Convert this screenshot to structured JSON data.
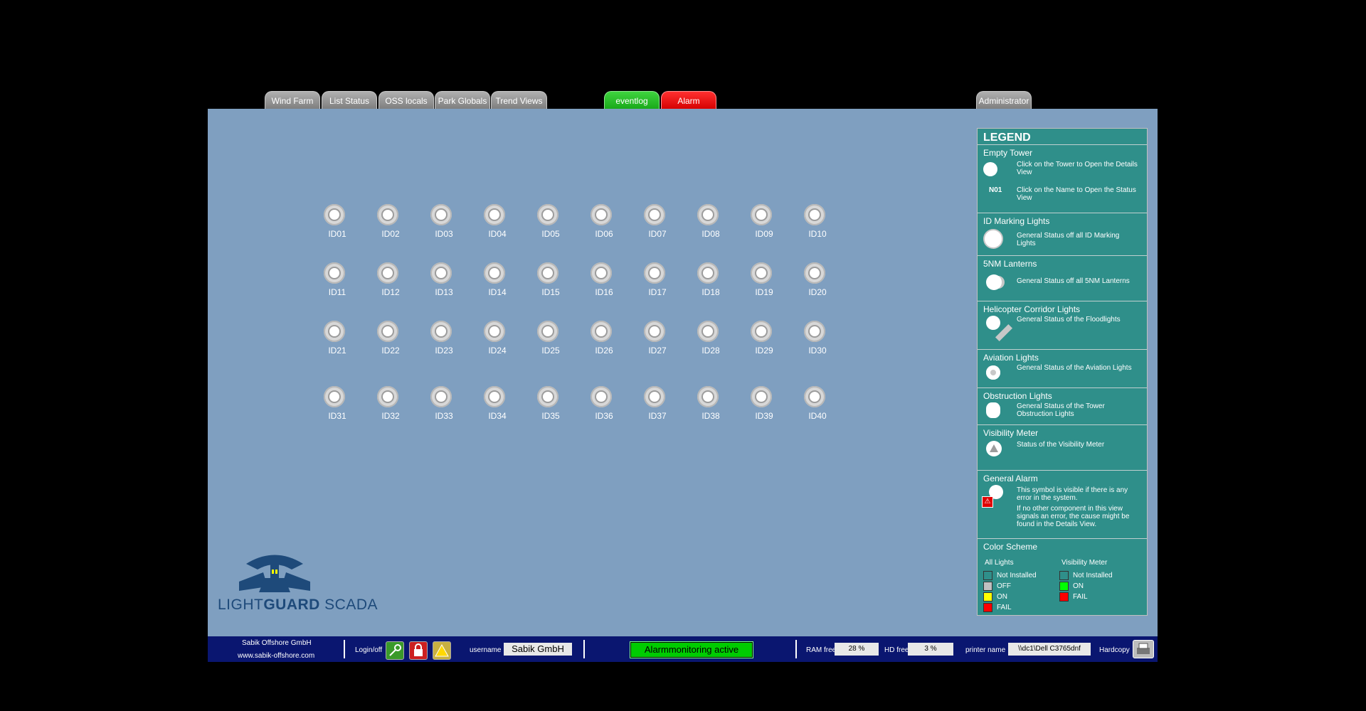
{
  "nav": {
    "tabs": [
      {
        "label": "Wind Farm"
      },
      {
        "label": "List Status"
      },
      {
        "label": "OSS locals"
      },
      {
        "label": "Park Globals"
      },
      {
        "label": "Trend Views"
      }
    ],
    "eventlog_label": "eventlog",
    "alarm_label": "Alarm",
    "admin_label": "Administrator"
  },
  "towers": [
    "ID01",
    "ID02",
    "ID03",
    "ID04",
    "ID05",
    "ID06",
    "ID07",
    "ID08",
    "ID09",
    "ID10",
    "ID11",
    "ID12",
    "ID13",
    "ID14",
    "ID15",
    "ID16",
    "ID17",
    "ID18",
    "ID19",
    "ID20",
    "ID21",
    "ID22",
    "ID23",
    "ID24",
    "ID25",
    "ID26",
    "ID27",
    "ID28",
    "ID29",
    "ID30",
    "ID31",
    "ID32",
    "ID33",
    "ID34",
    "ID35",
    "ID36",
    "ID37",
    "ID38",
    "ID39",
    "ID40"
  ],
  "logo": {
    "light": "LIGHT",
    "guard": "GUARD",
    "scada": " SCADA"
  },
  "legend": {
    "title": "LEGEND",
    "empty_tower": {
      "heading": "Empty Tower",
      "desc1": "Click on the Tower to Open the Details View",
      "name_sample": "N01",
      "desc2": "Click on the Name to Open the Status View"
    },
    "id_marking": {
      "heading": "ID Marking Lights",
      "desc": "General Status off all ID Marking Lights"
    },
    "lanterns": {
      "heading": "5NM Lanterns",
      "desc": "General Status off all 5NM Lanterns"
    },
    "heli": {
      "heading": "Helicopter Corridor Lights",
      "desc": "General Status of the Floodlights"
    },
    "aviation": {
      "heading": "Aviation Lights",
      "desc": "General Status of the Aviation Lights"
    },
    "obstruction": {
      "heading": "Obstruction Lights",
      "desc": "General Status of the Tower Obstruction Lights"
    },
    "visibility": {
      "heading": "Visibility Meter",
      "desc": "Status of the Visibility Meter"
    },
    "general_alarm": {
      "heading": "General Alarm",
      "desc1": "This symbol is visible if there is any error in the system.",
      "desc2": "If no other component in this view signals an error, the cause might be found in the Details View."
    },
    "color_scheme": {
      "heading": "Color Scheme",
      "all_lights_label": "All Lights",
      "visibility_label": "Visibility Meter",
      "all_lights": [
        {
          "label": "Not Installed",
          "color": "#2f8f8a"
        },
        {
          "label": "OFF",
          "color": "#c0c0c0"
        },
        {
          "label": "ON",
          "color": "#ffff00"
        },
        {
          "label": "FAIL",
          "color": "#ff0000"
        }
      ],
      "visibility": [
        {
          "label": "Not Installed",
          "color": "#2f8f8a"
        },
        {
          "label": "ON",
          "color": "#00ff00"
        },
        {
          "label": "FAIL",
          "color": "#ff0000"
        }
      ]
    }
  },
  "status": {
    "company": "Sabik Offshore GmbH",
    "website": "www.sabik-offshore.com",
    "login_label": "Login/off",
    "username_label": "username",
    "username": "Sabik GmbH",
    "alarm_status": "Alarmmonitoring active",
    "ram_label": "RAM free",
    "ram_value": "28 %",
    "hd_label": "HD free",
    "hd_value": "3 %",
    "printer_label": "printer name",
    "printer_value": "\\\\dc1\\Dell C3765dnf",
    "hardcopy_label": "Hardcopy"
  }
}
